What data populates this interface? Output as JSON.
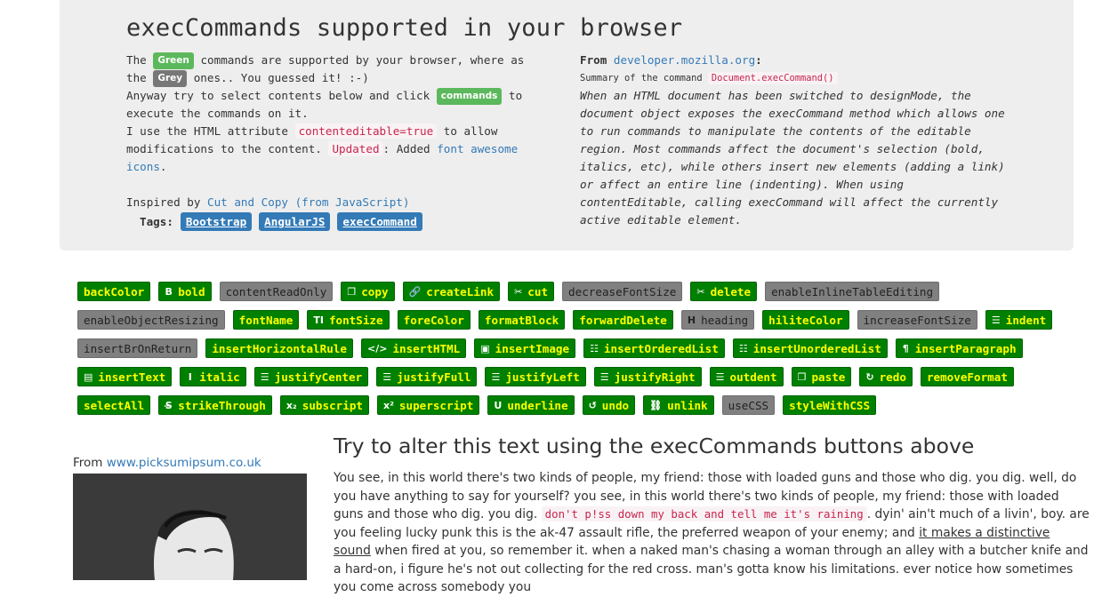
{
  "header": {
    "title": "execCommands supported in your browser",
    "intro": {
      "t1": "The ",
      "green_label": "Green",
      "t2": " commands are supported by your browser, where as the ",
      "grey_label": "Grey",
      "t3": " ones.. You guessed it! :-)",
      "t4": "Anyway try to select contents below and click ",
      "commands_label": "commands",
      "t5": " to execute the commands on it.",
      "t6": "I use the HTML attribute ",
      "attr_code": "contenteditable=true",
      "t7": " to allow modifications to the content. ",
      "updated_code": "Updated",
      "t8": ": Added ",
      "fa_link": "font awesome icons",
      "t9": ".",
      "inspired_prefix": "Inspired by ",
      "inspired_link": "Cut and Copy (from JavaScript)"
    },
    "tags_label": "Tags:",
    "tags": [
      "Bootstrap",
      "AngularJS",
      "execCommand"
    ],
    "from": {
      "prefix": "From ",
      "link": "developer.mozilla.org",
      "suffix": ":",
      "summary_prefix": "Summary of the command ",
      "summary_code": "Document.execCommand()",
      "quote": "When an HTML document has been switched to designMode, the document object exposes the execCommand method which allows one to run commands to manipulate the contents of the editable region. Most commands affect the document's selection (bold, italics, etc), while others insert new elements (adding a link) or affect an entire line (indenting). When using contentEditable, calling execCommand will affect the currently active editable element."
    }
  },
  "commands": [
    {
      "label": "backColor",
      "supported": true,
      "icon": ""
    },
    {
      "label": "bold",
      "supported": true,
      "icon": "bold-icon",
      "glyph": "B"
    },
    {
      "label": "contentReadOnly",
      "supported": false,
      "icon": ""
    },
    {
      "label": "copy",
      "supported": true,
      "icon": "copy-icon",
      "glyph": "❐"
    },
    {
      "label": "createLink",
      "supported": true,
      "icon": "link-icon",
      "glyph": "🔗"
    },
    {
      "label": "cut",
      "supported": true,
      "icon": "scissors-icon",
      "glyph": "✂"
    },
    {
      "label": "decreaseFontSize",
      "supported": false,
      "icon": ""
    },
    {
      "label": "delete",
      "supported": true,
      "icon": "scissors-icon",
      "glyph": "✂"
    },
    {
      "label": "enableInlineTableEditing",
      "supported": false,
      "icon": ""
    },
    {
      "label": "enableObjectResizing",
      "supported": false,
      "icon": ""
    },
    {
      "label": "fontName",
      "supported": true,
      "icon": ""
    },
    {
      "label": "fontSize",
      "supported": true,
      "icon": "text-height-icon",
      "glyph": "TI"
    },
    {
      "label": "foreColor",
      "supported": true,
      "icon": ""
    },
    {
      "label": "formatBlock",
      "supported": true,
      "icon": ""
    },
    {
      "label": "forwardDelete",
      "supported": true,
      "icon": ""
    },
    {
      "label": "heading",
      "supported": false,
      "icon": "header-icon",
      "glyph": "H"
    },
    {
      "label": "hiliteColor",
      "supported": true,
      "icon": ""
    },
    {
      "label": "increaseFontSize",
      "supported": false,
      "icon": ""
    },
    {
      "label": "indent",
      "supported": true,
      "icon": "indent-icon",
      "glyph": "☰"
    },
    {
      "label": "insertBrOnReturn",
      "supported": false,
      "icon": ""
    },
    {
      "label": "insertHorizontalRule",
      "supported": true,
      "icon": ""
    },
    {
      "label": "insertHTML",
      "supported": true,
      "icon": "code-icon",
      "glyph": "</>"
    },
    {
      "label": "insertImage",
      "supported": true,
      "icon": "image-icon",
      "glyph": "▣"
    },
    {
      "label": "insertOrderedList",
      "supported": true,
      "icon": "ordered-list-icon",
      "glyph": "☷"
    },
    {
      "label": "insertUnorderedList",
      "supported": true,
      "icon": "unordered-list-icon",
      "glyph": "☷"
    },
    {
      "label": "insertParagraph",
      "supported": true,
      "icon": "paragraph-icon",
      "glyph": "¶"
    },
    {
      "label": "insertText",
      "supported": true,
      "icon": "file-text-icon",
      "glyph": "▤"
    },
    {
      "label": "italic",
      "supported": true,
      "icon": "italic-icon",
      "glyph": "I"
    },
    {
      "label": "justifyCenter",
      "supported": true,
      "icon": "align-center-icon",
      "glyph": "☰"
    },
    {
      "label": "justifyFull",
      "supported": true,
      "icon": "align-justify-icon",
      "glyph": "☰"
    },
    {
      "label": "justifyLeft",
      "supported": true,
      "icon": "align-left-icon",
      "glyph": "☰"
    },
    {
      "label": "justifyRight",
      "supported": true,
      "icon": "align-right-icon",
      "glyph": "☰"
    },
    {
      "label": "outdent",
      "supported": true,
      "icon": "outdent-icon",
      "glyph": "☰"
    },
    {
      "label": "paste",
      "supported": true,
      "icon": "paste-icon",
      "glyph": "❐"
    },
    {
      "label": "redo",
      "supported": true,
      "icon": "redo-icon",
      "glyph": "↻"
    },
    {
      "label": "removeFormat",
      "supported": true,
      "icon": ""
    },
    {
      "label": "selectAll",
      "supported": true,
      "icon": ""
    },
    {
      "label": "strikeThrough",
      "supported": true,
      "icon": "strikethrough-icon",
      "glyph": "S̶"
    },
    {
      "label": "subscript",
      "supported": true,
      "icon": "subscript-icon",
      "glyph": "x₂"
    },
    {
      "label": "superscript",
      "supported": true,
      "icon": "superscript-icon",
      "glyph": "x²"
    },
    {
      "label": "underline",
      "supported": true,
      "icon": "underline-icon",
      "glyph": "U"
    },
    {
      "label": "undo",
      "supported": true,
      "icon": "undo-icon",
      "glyph": "↺"
    },
    {
      "label": "unlink",
      "supported": true,
      "icon": "unlink-icon",
      "glyph": "⛓"
    },
    {
      "label": "useCSS",
      "supported": false,
      "icon": ""
    },
    {
      "label": "styleWithCSS",
      "supported": true,
      "icon": ""
    }
  ],
  "photo": {
    "prefix": "From ",
    "link": "www.picksumipsum.co.uk"
  },
  "editor": {
    "title": "Try to alter this text using the execCommands buttons above",
    "p1": "You see, in this world there's two kinds of people, my friend: those with loaded guns and those who dig. you dig. well, do you have anything to say for yourself? you see, in this world there's two kinds of people, my friend: those with loaded guns and those who dig. you dig. ",
    "code": "don't p!ss down my back and tell me it's raining",
    "p2": ". dyin' ain't much of a livin', boy. are you feeling lucky punk this is the ak-47 assault rifle, the preferred weapon of your enemy; and ",
    "underlined": "it makes a distinctive sound",
    "p3": " when fired at you, so remember it. when a naked man's chasing a woman through an alley with a butcher knife and a hard-on, i figure he's not out collecting for the red cross. man's gotta know his limitations. ever notice how sometimes you come across somebody you"
  },
  "colors": {
    "supported_bg": "#008000",
    "supported_text": "#ffff00",
    "unsupported_bg": "#808080",
    "tag_bg": "#337ab7",
    "link": "#337ab7"
  }
}
